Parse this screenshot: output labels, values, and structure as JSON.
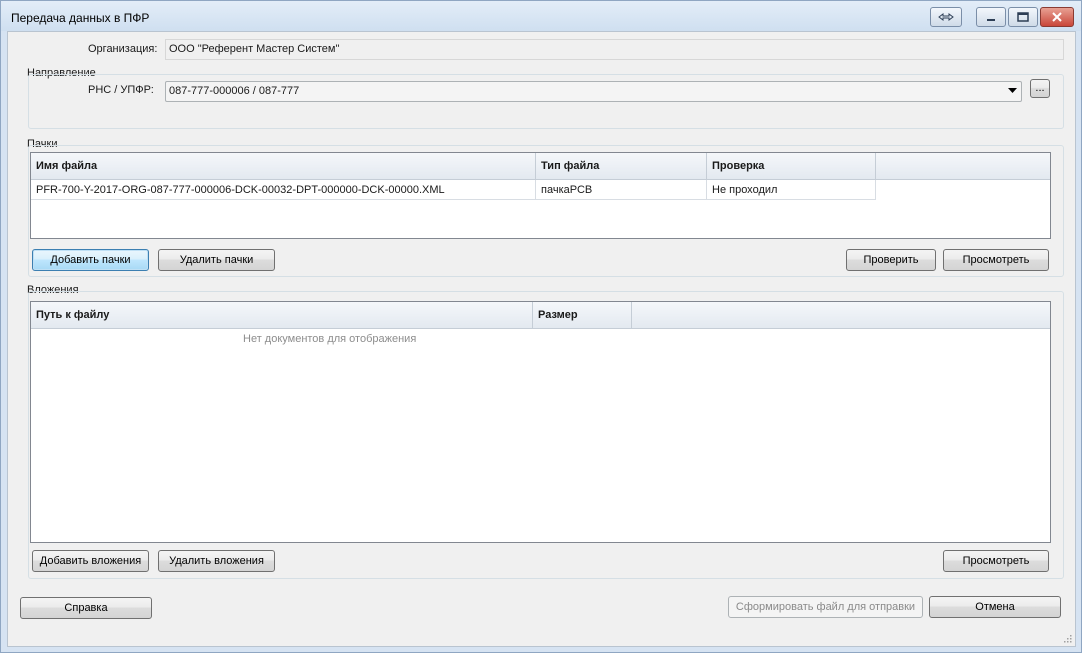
{
  "window": {
    "title": "Передача данных в ПФР"
  },
  "organization": {
    "label": "Организация:",
    "value": "ООО \"Референт Мастер Систем\""
  },
  "direction": {
    "group_label": "Направление",
    "field_label": "РНС / УПФР:",
    "selected": "087-777-000006 / 087-777",
    "browse_label": "..."
  },
  "packs": {
    "group_label": "Пачки",
    "columns": [
      "Имя файла",
      "Тип файла",
      "Проверка"
    ],
    "rows": [
      [
        "PFR-700-Y-2017-ORG-087-777-000006-DCK-00032-DPT-000000-DCK-00000.XML",
        "пачкаРСВ",
        "Не проходил"
      ]
    ],
    "add_label": "Добавить пачки",
    "remove_label": "Удалить пачки",
    "check_label": "Проверить",
    "view_label": "Просмотреть"
  },
  "attachments": {
    "group_label": "Вложения",
    "columns": [
      "Путь к файлу",
      "Размер"
    ],
    "empty_text": "Нет документов для отображения",
    "add_label": "Добавить вложения",
    "remove_label": "Удалить вложения",
    "view_label": "Просмотреть"
  },
  "footer": {
    "help_label": "Справка",
    "build_label": "Сформировать файл для отправки",
    "cancel_label": "Отмена"
  },
  "icons": {
    "restore": "restore-icon",
    "minimize": "minimize-icon",
    "maximize": "maximize-icon",
    "close": "close-icon",
    "dropdown": "chevron-down-icon",
    "grip": "resize-grip-icon"
  }
}
